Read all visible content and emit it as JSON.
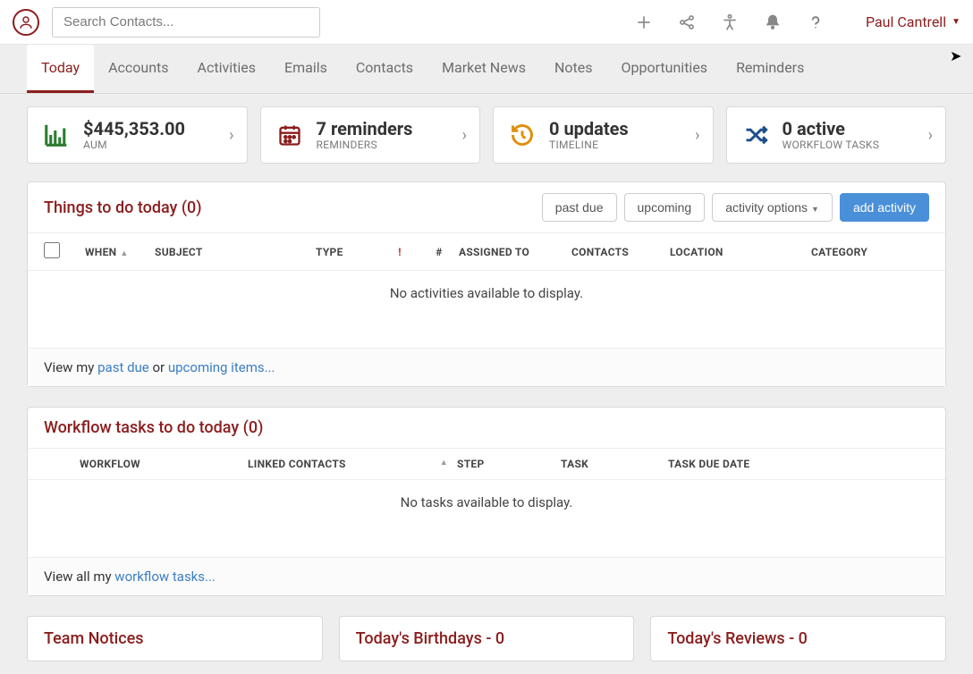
{
  "header": {
    "search_placeholder": "Search Contacts...",
    "user_name": "Paul Cantrell"
  },
  "tabs": [
    {
      "label": "Today",
      "active": true
    },
    {
      "label": "Accounts",
      "active": false
    },
    {
      "label": "Activities",
      "active": false
    },
    {
      "label": "Emails",
      "active": false
    },
    {
      "label": "Contacts",
      "active": false
    },
    {
      "label": "Market News",
      "active": false
    },
    {
      "label": "Notes",
      "active": false
    },
    {
      "label": "Opportunities",
      "active": false
    },
    {
      "label": "Reminders",
      "active": false
    }
  ],
  "stats": {
    "aum": {
      "value": "$445,353.00",
      "label": "AUM"
    },
    "reminders": {
      "value": "7 reminders",
      "label": "REMINDERS"
    },
    "updates": {
      "value": "0 updates",
      "label": "TIMELINE"
    },
    "workflow": {
      "value": "0 active",
      "label": "WORKFLOW TASKS"
    }
  },
  "todo": {
    "title": "Things to do today (0)",
    "buttons": {
      "past_due": "past due",
      "upcoming": "upcoming",
      "activity_options": "activity options",
      "add_activity": "add activity"
    },
    "columns": {
      "when": "WHEN",
      "subject": "SUBJECT",
      "type": "TYPE",
      "alert": "!",
      "hash": "#",
      "assigned": "ASSIGNED TO",
      "contacts": "CONTACTS",
      "location": "LOCATION",
      "category": "CATEGORY"
    },
    "empty": "No activities available to display.",
    "footer_prefix": "View my ",
    "footer_pastdue": "past due",
    "footer_or": " or ",
    "footer_upcoming": "upcoming items..."
  },
  "workflow": {
    "title": "Workflow tasks to do today (0)",
    "columns": {
      "workflow": "WORKFLOW",
      "linked": "LINKED CONTACTS",
      "step": "STEP",
      "task": "TASK",
      "due": "TASK DUE DATE"
    },
    "empty": "No tasks available to display.",
    "footer_prefix": "View all my ",
    "footer_link": "workflow tasks..."
  },
  "bottom": {
    "team_notices": "Team Notices",
    "birthdays": "Today's Birthdays - 0",
    "reviews": "Today's Reviews - 0"
  }
}
